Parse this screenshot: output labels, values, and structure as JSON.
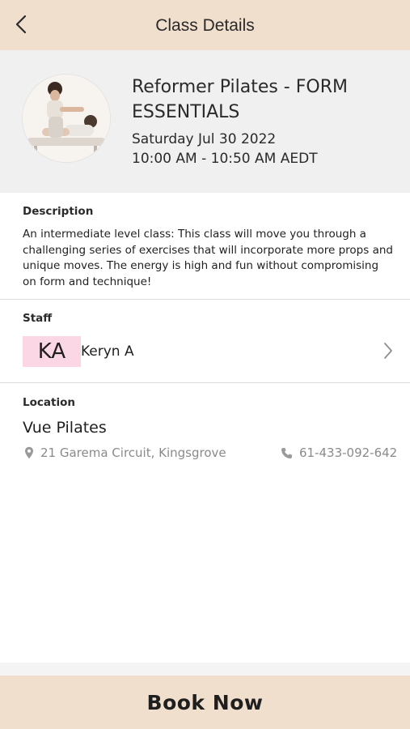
{
  "header": {
    "title": "Class Details",
    "back_icon": "chevron-left-icon"
  },
  "class": {
    "title": "Reformer Pilates - FORM ESSENTIALS",
    "date": "Saturday Jul 30 2022",
    "time": "10:00 AM - 10:50 AM AEDT"
  },
  "description": {
    "label": "Description",
    "text": "An intermediate level class: This class will move you through a challenging series of exercises that will incorporate more props and unique moves. The energy is high and fun without compromising on form and technique!"
  },
  "staff": {
    "label": "Staff",
    "initials": "KA",
    "name": "Keryn A",
    "avatar_color": "#fbd6e4"
  },
  "location": {
    "label": "Location",
    "name": "Vue Pilates",
    "address": "21 Garema Circuit, Kingsgrove",
    "phone": "61-433-092-642",
    "address_icon": "map-pin-icon",
    "phone_icon": "phone-icon"
  },
  "footer": {
    "book_label": "Book Now"
  },
  "colors": {
    "accent": "#f0dfcd",
    "summary_bg": "#f0f0f0",
    "muted_text": "#8a8a8a"
  }
}
